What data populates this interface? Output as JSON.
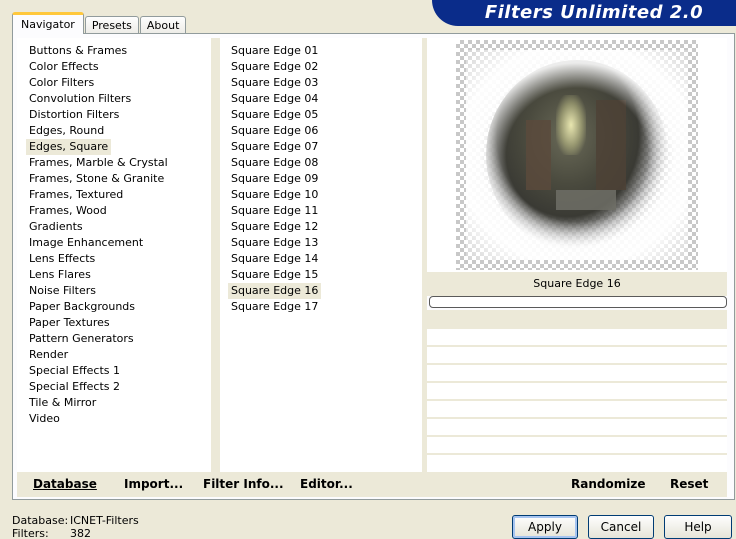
{
  "tabs": [
    {
      "label": "Navigator",
      "active": true
    },
    {
      "label": "Presets",
      "active": false
    },
    {
      "label": "About",
      "active": false
    }
  ],
  "app_title": "Filters Unlimited 2.0",
  "categories": [
    "Buttons & Frames",
    "Color Effects",
    "Color Filters",
    "Convolution Filters",
    "Distortion Filters",
    "Edges, Round",
    "Edges, Square",
    "Frames, Marble & Crystal",
    "Frames, Stone & Granite",
    "Frames, Textured",
    "Frames, Wood",
    "Gradients",
    "Image Enhancement",
    "Lens Effects",
    "Lens Flares",
    "Noise Filters",
    "Paper Backgrounds",
    "Paper Textures",
    "Pattern Generators",
    "Render",
    "Special Effects 1",
    "Special Effects 2",
    "Tile & Mirror",
    "Video"
  ],
  "selected_category": "Edges, Square",
  "filters": [
    "Square Edge 01",
    "Square Edge 02",
    "Square Edge 03",
    "Square Edge 04",
    "Square Edge 05",
    "Square Edge 06",
    "Square Edge 07",
    "Square Edge 08",
    "Square Edge 09",
    "Square Edge 10",
    "Square Edge 11",
    "Square Edge 12",
    "Square Edge 13",
    "Square Edge 14",
    "Square Edge 15",
    "Square Edge 16",
    "Square Edge 17"
  ],
  "selected_filter": "Square Edge 16",
  "preview": {
    "caption": "Square Edge 16",
    "progress": 0
  },
  "bottom_links": {
    "database": "Database",
    "import": "Import...",
    "filter_info": "Filter Info...",
    "editor": "Editor...",
    "randomize": "Randomize",
    "reset": "Reset"
  },
  "status": {
    "database_label": "Database:",
    "database_value": "ICNET-Filters",
    "filters_label": "Filters:",
    "filters_value": "382"
  },
  "buttons": {
    "apply": "Apply",
    "cancel": "Cancel",
    "help": "Help"
  }
}
